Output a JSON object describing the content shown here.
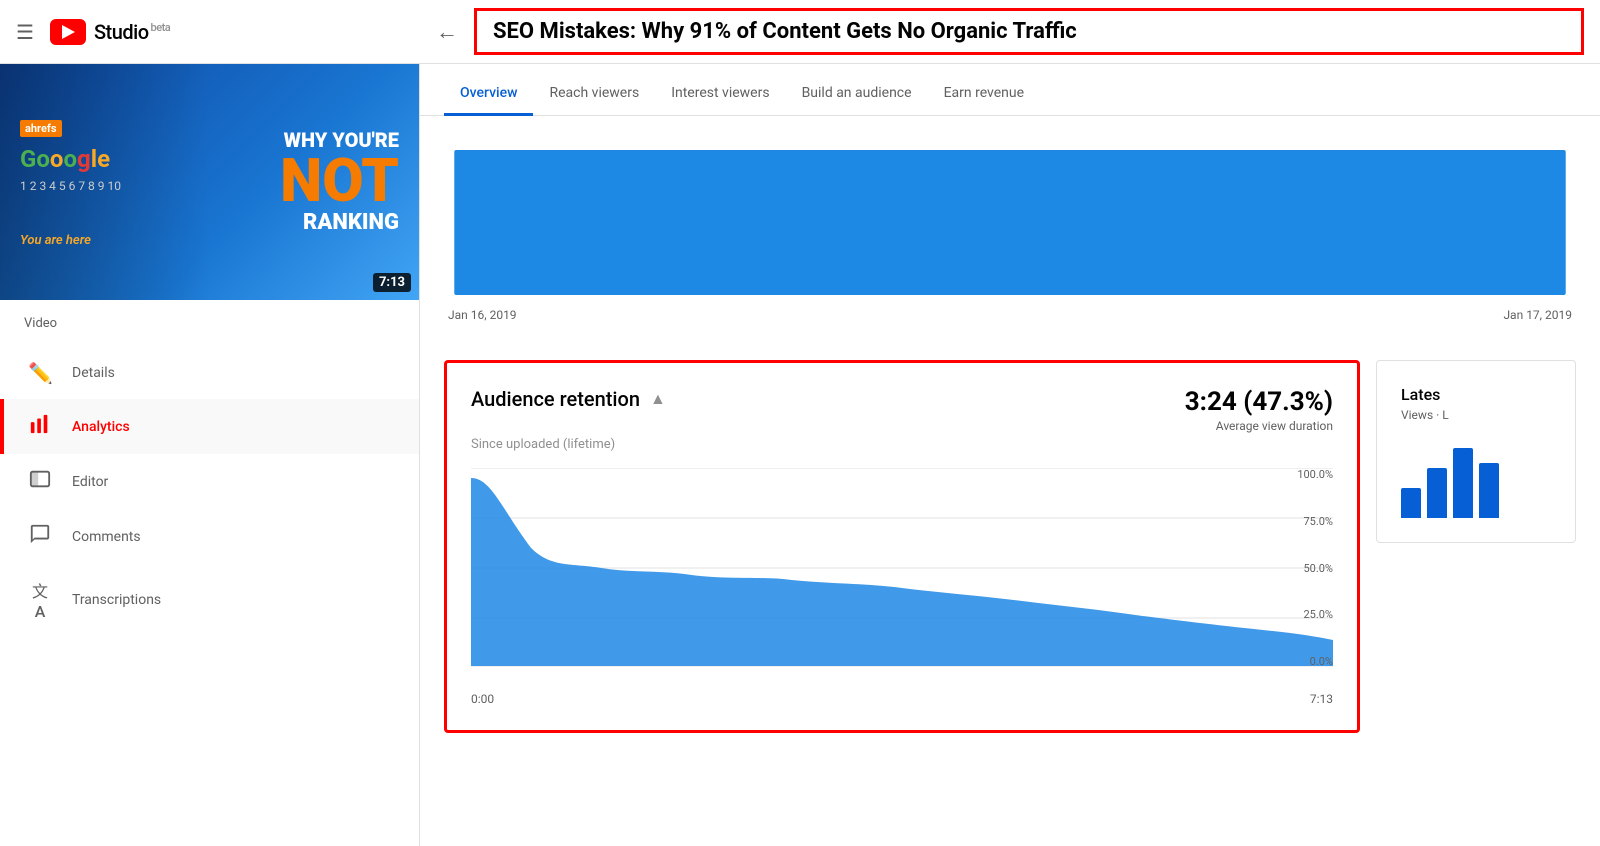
{
  "header": {
    "hamburger": "☰",
    "logo_text": "Studio",
    "beta": "beta",
    "back_arrow": "←",
    "video_title": "SEO Mistakes: Why 91% of Content Gets No Organic Traffic"
  },
  "thumbnail": {
    "ahrefs": "ahrefs",
    "google_label": "Gooogle",
    "you_are_here": "You are here",
    "why": "WHY YOU'RE",
    "not": "NOT",
    "ranking": "RANKING",
    "duration": "7:13"
  },
  "sidebar": {
    "video_label": "Video",
    "items": [
      {
        "id": "details",
        "icon": "✏",
        "label": "Details",
        "active": false
      },
      {
        "id": "analytics",
        "icon": "📊",
        "label": "Analytics",
        "active": true
      },
      {
        "id": "editor",
        "icon": "🎬",
        "label": "Editor",
        "active": false
      },
      {
        "id": "comments",
        "icon": "💬",
        "label": "Comments",
        "active": false
      },
      {
        "id": "transcriptions",
        "icon": "文A",
        "label": "Transcriptions",
        "active": false
      }
    ]
  },
  "tabs": [
    {
      "id": "overview",
      "label": "Overview",
      "active": true
    },
    {
      "id": "reach",
      "label": "Reach viewers",
      "active": false
    },
    {
      "id": "interest",
      "label": "Interest viewers",
      "active": false
    },
    {
      "id": "audience",
      "label": "Build an audience",
      "active": false
    },
    {
      "id": "revenue",
      "label": "Earn revenue",
      "active": false
    }
  ],
  "chart": {
    "date_start": "Jan 16, 2019",
    "date_end": "Jan 17, 2019"
  },
  "retention_card": {
    "title": "Audience retention",
    "subtitle": "Since uploaded (lifetime)",
    "metric_value": "3:24 (47.3%)",
    "metric_label": "Average view duration",
    "y_labels": [
      "100.0%",
      "75.0%",
      "50.0%",
      "25.0%",
      "0.0%"
    ],
    "x_start": "0:00",
    "x_end": "7:13"
  },
  "latest_card": {
    "title": "Lates",
    "subtitle": "Views · L"
  },
  "colors": {
    "accent": "#065fd4",
    "red": "#ff0000",
    "chart_blue": "#1e88e5",
    "light_gray": "#e0e0e0"
  }
}
